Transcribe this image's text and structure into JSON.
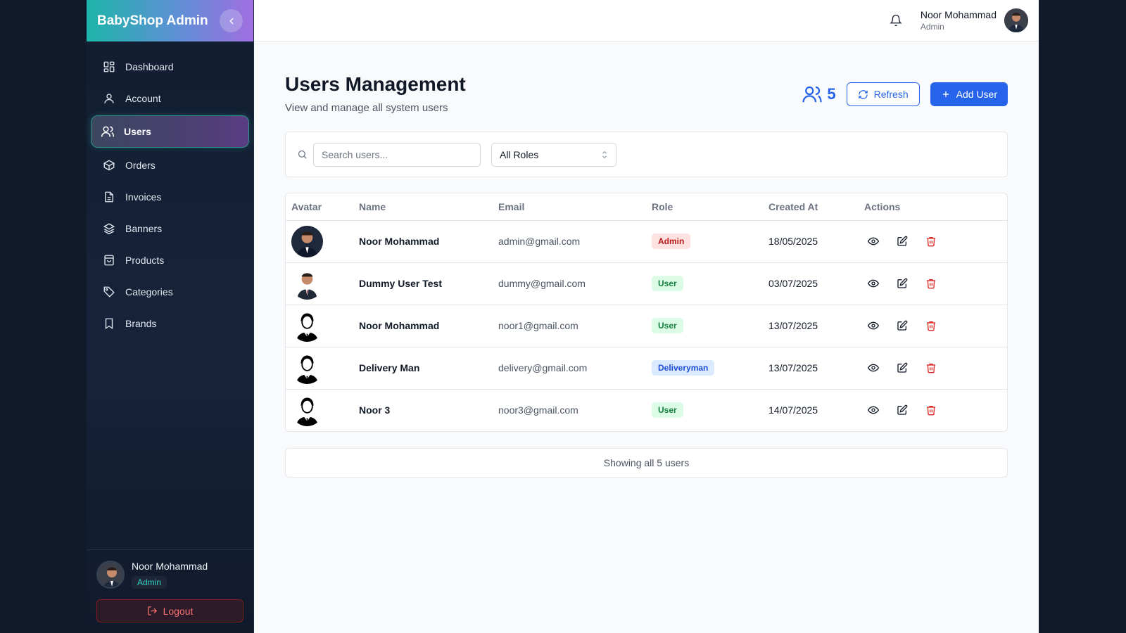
{
  "sidebar": {
    "brand": "BabyShop Admin",
    "items": [
      {
        "label": "Dashboard",
        "icon": "dashboard-icon"
      },
      {
        "label": "Account",
        "icon": "user-icon"
      },
      {
        "label": "Users",
        "icon": "users-icon",
        "active": true
      },
      {
        "label": "Orders",
        "icon": "box-icon"
      },
      {
        "label": "Invoices",
        "icon": "file-icon"
      },
      {
        "label": "Banners",
        "icon": "layers-icon"
      },
      {
        "label": "Products",
        "icon": "shopping-bag-icon"
      },
      {
        "label": "Categories",
        "icon": "tag-icon"
      },
      {
        "label": "Brands",
        "icon": "bookmark-icon"
      }
    ],
    "user": {
      "name": "Noor Mohammad",
      "role": "Admin"
    },
    "logout_label": "Logout"
  },
  "topbar": {
    "user_name": "Noor Mohammad",
    "user_role": "Admin"
  },
  "page": {
    "title": "Users Management",
    "subtitle": "View and manage all system users",
    "user_count": "5",
    "refresh_label": "Refresh",
    "add_label": "Add User"
  },
  "filters": {
    "search_placeholder": "Search users...",
    "role_selected": "All Roles"
  },
  "table": {
    "headers": {
      "avatar": "Avatar",
      "name": "Name",
      "email": "Email",
      "role": "Role",
      "created": "Created At",
      "actions": "Actions"
    },
    "rows": [
      {
        "name": "Noor Mohammad",
        "email": "admin@gmail.com",
        "role": "Admin",
        "created": "18/05/2025",
        "avatar": "photo-dark"
      },
      {
        "name": "Dummy User Test",
        "email": "dummy@gmail.com",
        "role": "User",
        "created": "03/07/2025",
        "avatar": "photo-light"
      },
      {
        "name": "Noor Mohammad",
        "email": "noor1@gmail.com",
        "role": "User",
        "created": "13/07/2025",
        "avatar": "silhouette"
      },
      {
        "name": "Delivery Man",
        "email": "delivery@gmail.com",
        "role": "Deliveryman",
        "created": "13/07/2025",
        "avatar": "silhouette"
      },
      {
        "name": "Noor 3",
        "email": "noor3@gmail.com",
        "role": "User",
        "created": "14/07/2025",
        "avatar": "silhouette"
      }
    ]
  },
  "footer": {
    "text": "Showing all 5 users"
  },
  "colors": {
    "accent": "#2563eb",
    "danger": "#dc2626",
    "teal": "#2dd4bf",
    "sidebar_bg": "#121d30"
  }
}
